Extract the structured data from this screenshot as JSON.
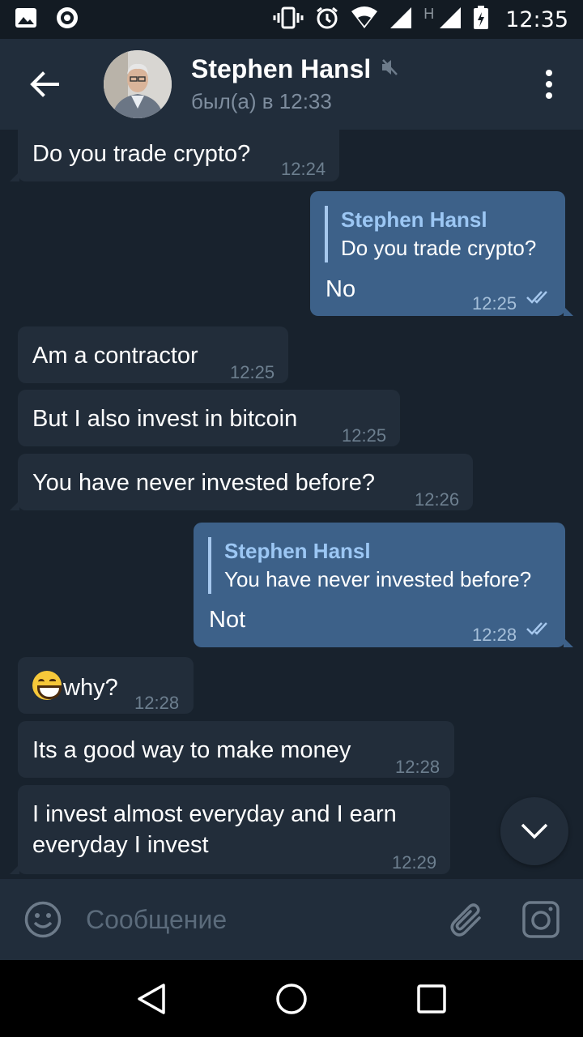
{
  "status_bar": {
    "time": "12:35",
    "network_label": "H"
  },
  "header": {
    "title": "Stephen Hansl",
    "subtitle": "был(а) в 12:33"
  },
  "messages": [
    {
      "text": "Do you trade crypto?",
      "time": "12:24"
    },
    {
      "reply_name": "Stephen Hansl",
      "reply_text": "Do you trade crypto?",
      "text": "No",
      "time": "12:25"
    },
    {
      "text": "Am a contractor",
      "time": "12:25"
    },
    {
      "text": "But I also invest in bitcoin",
      "time": "12:25"
    },
    {
      "text": "You have never invested before?",
      "time": "12:26"
    },
    {
      "reply_name": "Stephen Hansl",
      "reply_text": "You have never invested before?",
      "text": "Not",
      "time": "12:28"
    },
    {
      "text": "why?",
      "time": "12:28"
    },
    {
      "text": "Its a good way to make money",
      "time": "12:28"
    },
    {
      "text_line1": "I invest almost everyday and I earn",
      "text_line2": "everyday I invest",
      "time": "12:29"
    }
  ],
  "input": {
    "placeholder": "Сообщение"
  },
  "colors": {
    "background": "#18222d",
    "header": "#212d3b",
    "incoming": "#222d3a",
    "outgoing": "#3d6189",
    "accent": "#9cc7f4"
  }
}
